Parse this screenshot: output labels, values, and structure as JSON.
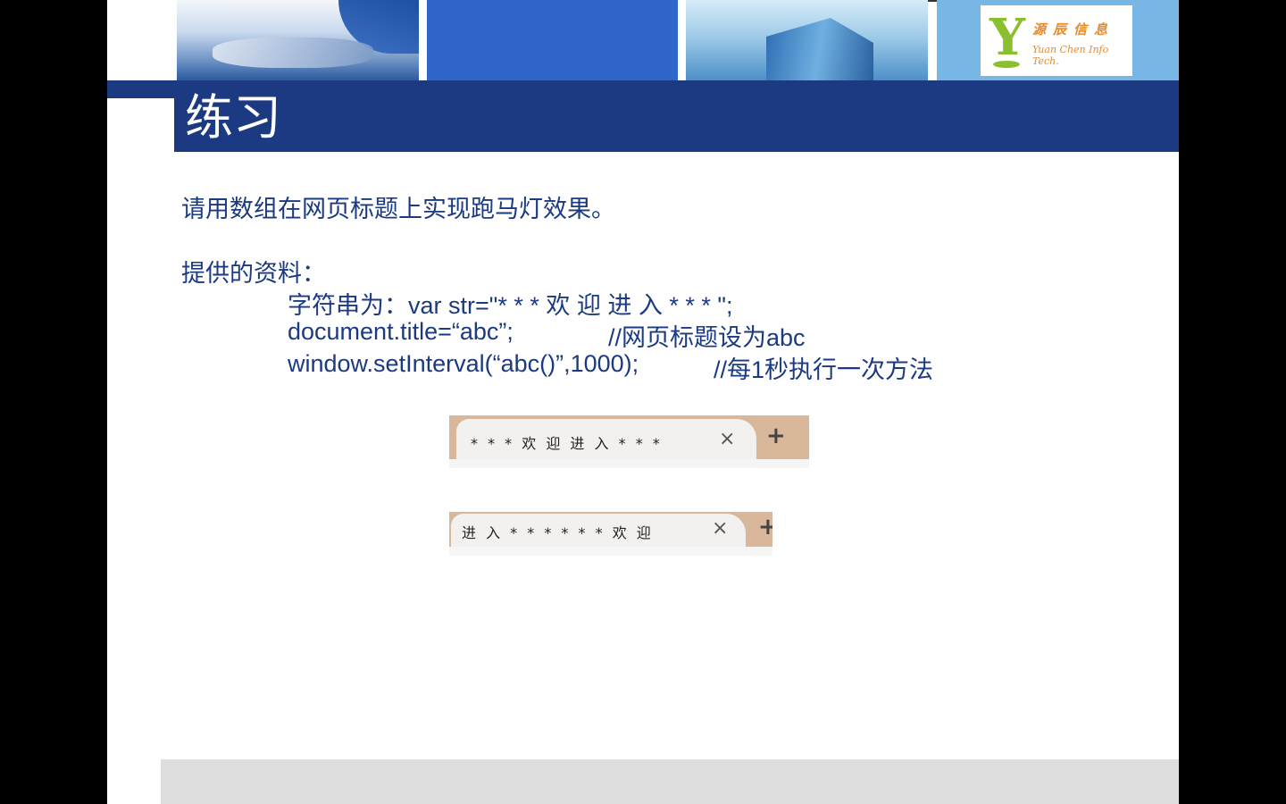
{
  "header": {
    "logo": {
      "chinese": "源辰信息",
      "english": "Yuan Chen Info Tech."
    }
  },
  "title": "练习",
  "content": {
    "task": "请用数组在网页标题上实现跑马灯效果。",
    "materials_label": "提供的资料：",
    "line1": "字符串为：var str=\"* * * 欢 迎 进 入 * * * \";",
    "line2_code": "document.title=“abc”;",
    "line2_comment": "//网页标题设为abc",
    "line3_code": "window.setInterval(“abc()”,1000);",
    "line3_comment": "//每1秒执行一次方法"
  },
  "tabs": [
    {
      "title": "* * * 欢 迎 进 入 * * *",
      "close": "×",
      "new_tab": "+"
    },
    {
      "title": "进 入 * * * * * * 欢 迎",
      "close": "×",
      "new_tab": "+"
    }
  ],
  "colors": {
    "title_band": "#1b3a82",
    "text": "#1b3a82",
    "tab_bg": "#d9b79a"
  }
}
